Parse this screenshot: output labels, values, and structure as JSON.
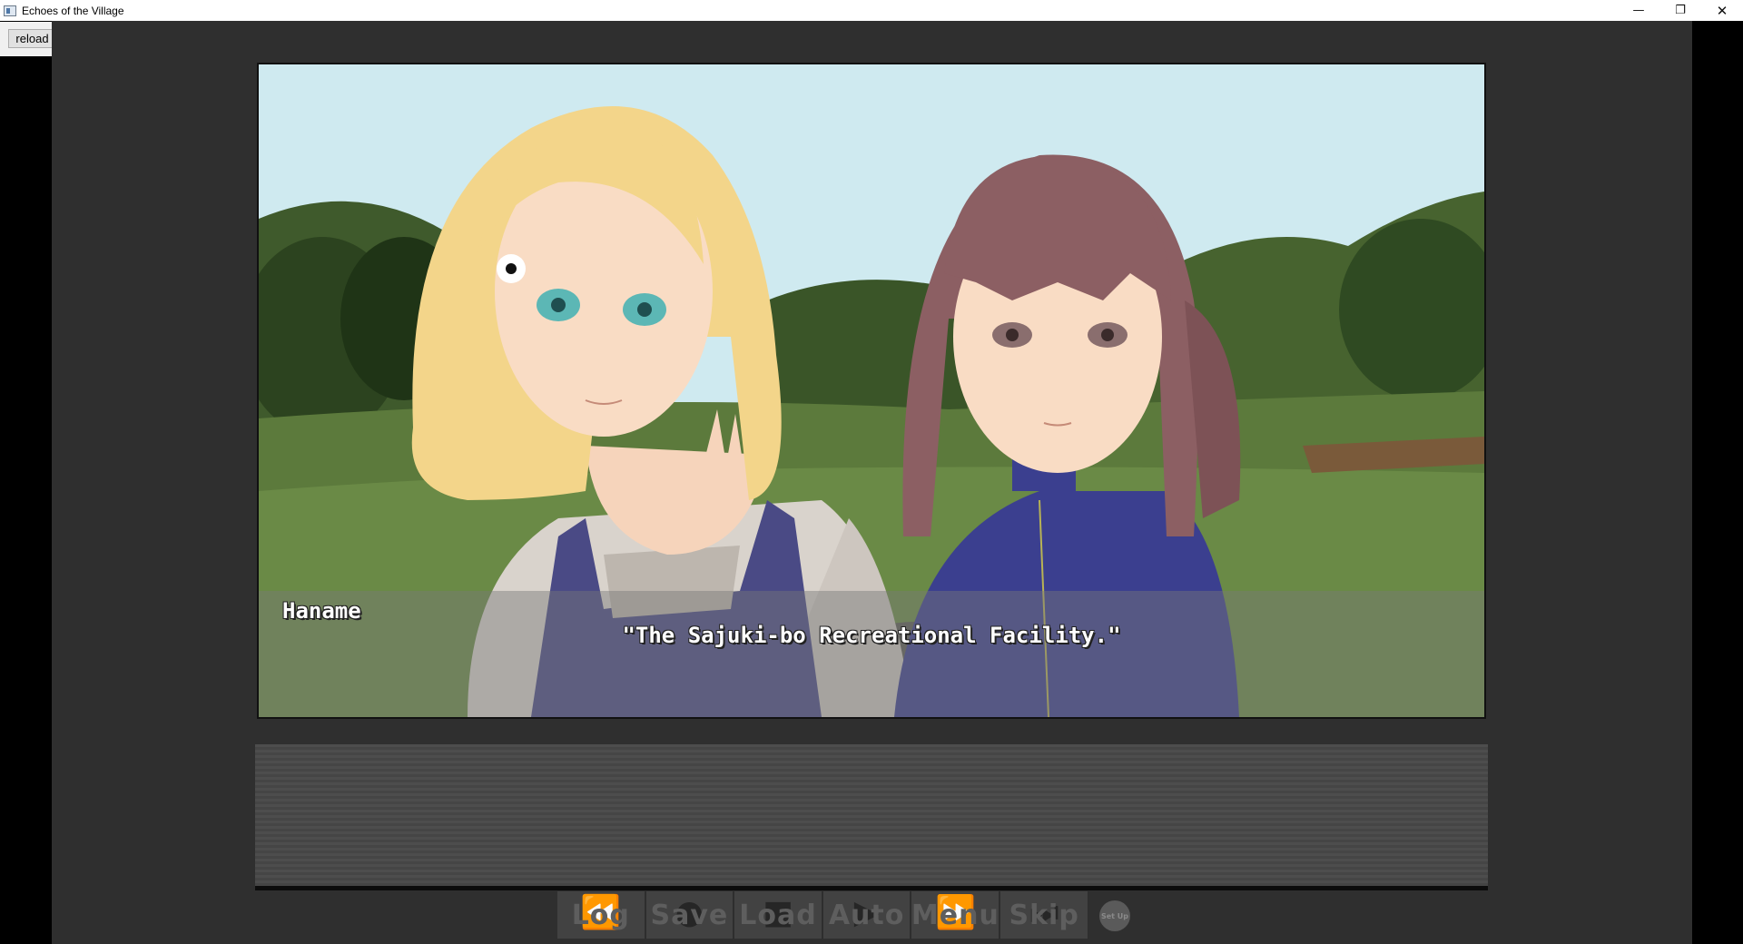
{
  "window": {
    "title": "Echoes of the Village",
    "minimize_glyph": "—",
    "restore_glyph": "❐",
    "close_glyph": "✕"
  },
  "toolbar": {
    "reload_label": "reload"
  },
  "scene": {
    "speaker": "Haname",
    "dialogue": "\"The Sajuki-bo Recreational Facility.\""
  },
  "menu": {
    "items": [
      {
        "label": "Log",
        "icon": "rewind-icon",
        "glyph": "⏪"
      },
      {
        "label": "Save",
        "icon": "circle-icon",
        "glyph": "●"
      },
      {
        "label": "Load",
        "icon": "square-icon",
        "glyph": "■"
      },
      {
        "label": "Auto",
        "icon": "play-icon",
        "glyph": "▶"
      },
      {
        "label": "Menu",
        "icon": "fast-forward-icon",
        "glyph": "⏩"
      },
      {
        "label": "Skip",
        "icon": "skip-icon",
        "glyph": "⏭"
      }
    ],
    "setup_label": "Set Up"
  },
  "colors": {
    "game_background": "#2f2f2f",
    "sky": "#cfeaf0",
    "grass": "#5c7a3c",
    "blonde_hair": "#f3d58a",
    "brown_hair": "#8c5f63",
    "overall_navy": "#4a4a85",
    "jacket_blue": "#3b3f8f"
  }
}
